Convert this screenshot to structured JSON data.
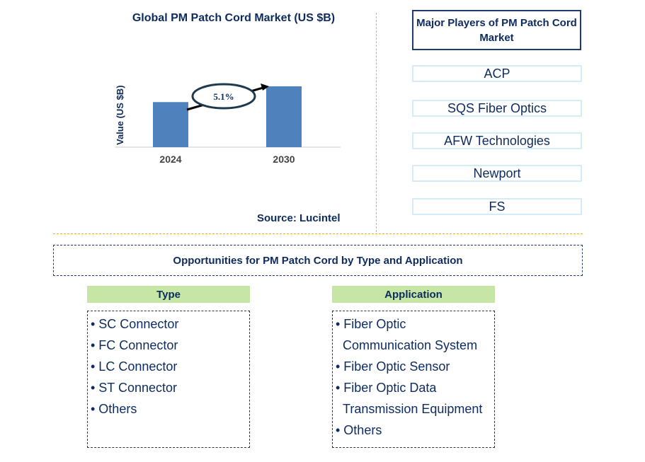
{
  "chart_data": {
    "type": "bar",
    "title": "Global PM Patch Cord Market (US $B)",
    "ylabel": "Value (US $B)",
    "xlabel": "",
    "categories": [
      "2024",
      "2030"
    ],
    "values": [
      1.0,
      1.35
    ],
    "annotation": "5.1%",
    "bar_color": "#4f81bd",
    "grid": false
  },
  "source": "Source: Lucintel",
  "players": {
    "title": "Major Players of PM Patch Cord Market",
    "items": [
      "ACP",
      "SQS Fiber Optics",
      "AFW Technologies",
      "Newport",
      "FS"
    ]
  },
  "opportunities": {
    "title": "Opportunities for PM Patch Cord by Type and Application",
    "type": {
      "title": "Type",
      "items": [
        "• SC Connector",
        "• FC Connector",
        "• LC Connector",
        "• ST Connector",
        "• Others"
      ]
    },
    "application": {
      "title": "Application",
      "lines": [
        "• Fiber Optic",
        "Communication System",
        "• Fiber Optic Sensor",
        "• Fiber Optic Data",
        "Transmission Equipment",
        "• Others"
      ]
    }
  }
}
